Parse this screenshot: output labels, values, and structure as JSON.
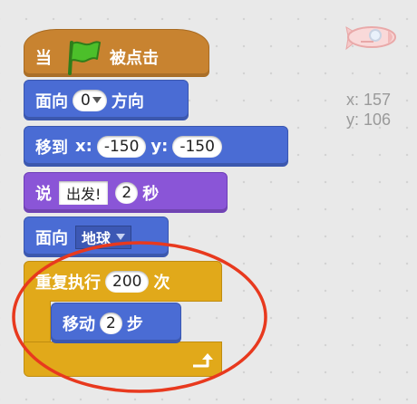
{
  "script": {
    "hat": {
      "prefix": "当",
      "suffix": "被点击",
      "icon": "green-flag-icon",
      "color": "#c88330"
    },
    "point_direction": {
      "label_a": "面向",
      "value": "0",
      "label_b": "方向"
    },
    "go_to": {
      "label": "移到",
      "x_label": "x:",
      "x_value": "-150",
      "y_label": "y:",
      "y_value": "-150"
    },
    "say": {
      "label": "说",
      "message": "出发!",
      "seconds_value": "2",
      "seconds_label": "秒"
    },
    "point_towards": {
      "label": "面向",
      "target": "地球"
    },
    "repeat": {
      "label": "重复执行",
      "count": "200",
      "suffix": "次",
      "color": "#e1a91a"
    },
    "move": {
      "label": "移动",
      "steps": "2",
      "suffix": "步"
    }
  },
  "sprite_info": {
    "icon": "rocket-sprite-icon",
    "x_label": "x:",
    "x_value": "157",
    "y_label": "y:",
    "y_value": "106"
  },
  "annotation": {
    "shape": "circle-highlight",
    "color": "#e8391e"
  },
  "colors": {
    "motion": "#4a6cd4",
    "looks": "#8a55d7",
    "control": "#e1a91a",
    "events": "#c88330"
  }
}
